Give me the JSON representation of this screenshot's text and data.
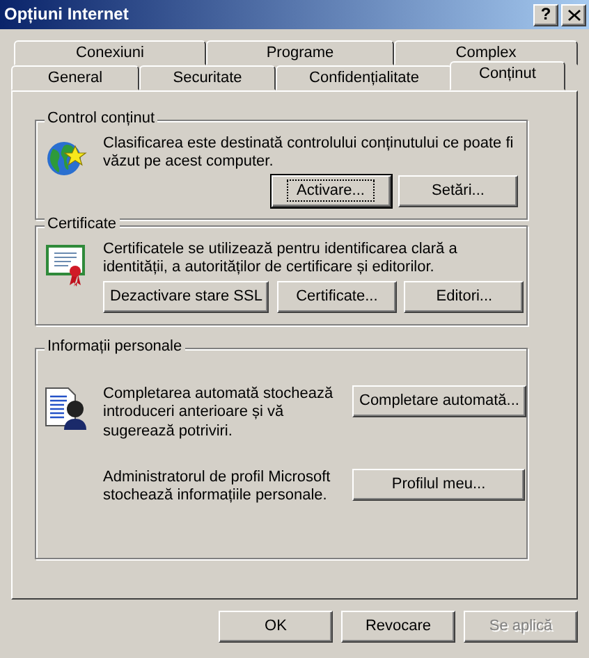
{
  "window": {
    "title": "Opțiuni Internet",
    "help_button": "?"
  },
  "tab_rows": [
    [
      {
        "label": "Conexiuni",
        "selected": false
      },
      {
        "label": "Programe",
        "selected": false
      },
      {
        "label": "Complex",
        "selected": false
      }
    ],
    [
      {
        "label": "General",
        "selected": false
      },
      {
        "label": "Securitate",
        "selected": false
      },
      {
        "label": "Confidențialitate",
        "selected": false
      },
      {
        "label": "Conținut",
        "selected": true
      }
    ]
  ],
  "groups": [
    {
      "title": "Control conținut",
      "rows": [
        {
          "text": "Clasificarea este destinată controlului conținutului ce poate fi văzut pe acest computer.",
          "buttons": [
            {
              "label": "Activare...",
              "default": true
            },
            {
              "label": "Setări...",
              "default": false
            }
          ]
        }
      ]
    },
    {
      "title": "Certificate",
      "rows": [
        {
          "text": "Certificatele se utilizează pentru identificarea clară a identității, a autorităților de certificare și editorilor.",
          "buttons": [
            {
              "label": "Dezactivare stare SSL",
              "default": false
            },
            {
              "label": "Certificate...",
              "default": false
            },
            {
              "label": "Editori...",
              "default": false
            }
          ]
        }
      ]
    },
    {
      "title": "Informații personale",
      "rows": [
        {
          "text": "Completarea automată stochează introduceri anterioare și vă sugerează potriviri.",
          "buttons": [
            {
              "label": "Completare automată...",
              "default": false
            }
          ]
        },
        {
          "text": "Administratorul de profil Microsoft stochează informațiile personale.",
          "buttons": [
            {
              "label": "Profilul meu...",
              "default": false
            }
          ]
        }
      ]
    }
  ],
  "footer_buttons": [
    {
      "label": "OK",
      "disabled": false
    },
    {
      "label": "Revocare",
      "disabled": false
    },
    {
      "label": "Se aplică",
      "disabled": true
    }
  ]
}
